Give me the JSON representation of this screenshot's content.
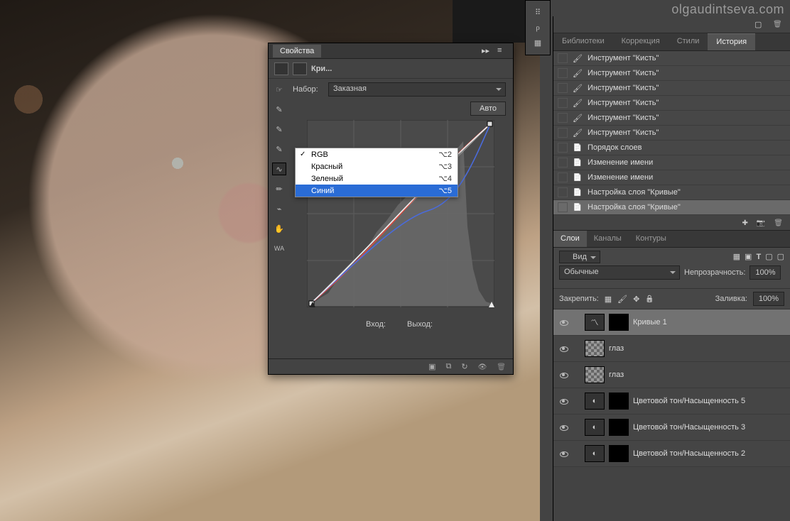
{
  "watermark": "olgaudintseva.com",
  "props": {
    "panel_title": "Свойства",
    "adj_label": "Кри...",
    "preset_label": "Набор:",
    "preset_value": "Заказная",
    "auto_btn": "Авто",
    "input_label": "Вход:",
    "output_label": "Выход:"
  },
  "channels_menu": [
    {
      "label": "RGB",
      "shortcut": "⌥2",
      "checked": true
    },
    {
      "label": "Красный",
      "shortcut": "⌥3"
    },
    {
      "label": "Зеленый",
      "shortcut": "⌥4"
    },
    {
      "label": "Синий",
      "shortcut": "⌥5",
      "highlight": true
    }
  ],
  "tabs": {
    "items": [
      "Библиотеки",
      "Коррекция",
      "Стили",
      "История"
    ],
    "active": 3
  },
  "history": [
    {
      "icon": "brush",
      "label": "Инструмент \"Кисть\""
    },
    {
      "icon": "brush",
      "label": "Инструмент \"Кисть\""
    },
    {
      "icon": "brush",
      "label": "Инструмент \"Кисть\""
    },
    {
      "icon": "brush",
      "label": "Инструмент \"Кисть\""
    },
    {
      "icon": "brush",
      "label": "Инструмент \"Кисть\""
    },
    {
      "icon": "brush",
      "label": "Инструмент \"Кисть\""
    },
    {
      "icon": "doc",
      "label": "Порядок слоев"
    },
    {
      "icon": "doc",
      "label": "Изменение имени"
    },
    {
      "icon": "doc",
      "label": "Изменение имени"
    },
    {
      "icon": "doc",
      "label": "Настройка слоя \"Кривые\""
    },
    {
      "icon": "doc",
      "label": "Настройка слоя \"Кривые\"",
      "selected": true
    }
  ],
  "layers_panel": {
    "tabs": [
      "Слои",
      "Каналы",
      "Контуры"
    ],
    "active": 0,
    "filter_label": "Вид",
    "blend_label": "Обычные",
    "opacity_label": "Непрозрачность:",
    "opacity_value": "100%",
    "lock_label": "Закрепить:",
    "fill_label": "Заливка:",
    "fill_value": "100%",
    "layers": [
      {
        "type": "curves",
        "name": "Кривые 1",
        "selected": true
      },
      {
        "type": "paint",
        "name": "глаз"
      },
      {
        "type": "paint",
        "name": "глаз"
      },
      {
        "type": "huesat",
        "name": "Цветовой тон/Насыщенность 5"
      },
      {
        "type": "huesat",
        "name": "Цветовой тон/Насыщенность 3"
      },
      {
        "type": "huesat",
        "name": "Цветовой тон/Насыщенность 2"
      }
    ]
  }
}
